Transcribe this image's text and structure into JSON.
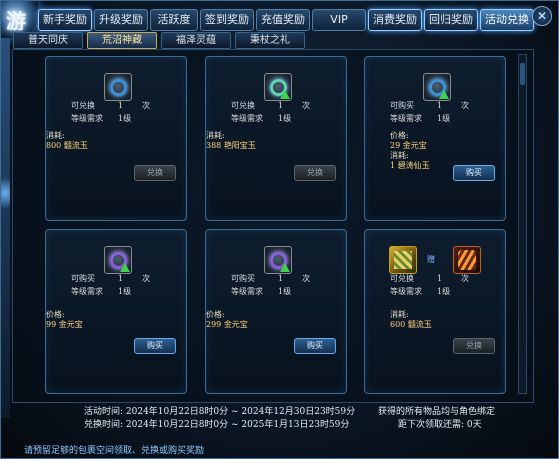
{
  "top_tabs": [
    "新手奖励",
    "升级奖励",
    "活跃度",
    "签到奖励",
    "充值奖励",
    "VIP",
    "消费奖励",
    "回归奖励",
    "活动兑换"
  ],
  "sub_tabs": [
    "普天同庆",
    "荒沼神藏",
    "福泽灵蕴",
    "秉杖之礼"
  ],
  "cards": [
    {
      "lines": [
        {
          "label": "可兑换",
          "value": "1",
          "unit": "次"
        },
        {
          "label": "等级需求",
          "value": "1级"
        }
      ],
      "cost_label": "消耗:",
      "cost": [
        "800 髓流玉"
      ],
      "button": "兑换",
      "icon": "blue-ring-icon"
    },
    {
      "lines": [
        {
          "label": "可兑换",
          "value": "1",
          "unit": "次"
        },
        {
          "label": "等级需求",
          "value": "1级"
        }
      ],
      "cost_label": "消耗:",
      "cost": [
        "388 艳阳宝玉"
      ],
      "button": "兑换",
      "icon": "teal-ring-icon"
    },
    {
      "lines": [
        {
          "label": "可购买",
          "value": "1",
          "unit": "次"
        },
        {
          "label": "等级需求",
          "value": "1级"
        }
      ],
      "cost_label": "价格:",
      "cost": [
        "29 金元宝"
      ],
      "extra_label": "消耗:",
      "extra": "1 碧涛仙玉",
      "button": "购买",
      "icon": "blue-ring-icon"
    },
    {
      "lines": [
        {
          "label": "可购买",
          "value": "1",
          "unit": "次"
        },
        {
          "label": "等级需求",
          "value": "1级"
        }
      ],
      "cost_label": "价格:",
      "cost": [
        "99 金元宝"
      ],
      "button": "购买",
      "icon": "purple-ring-icon"
    },
    {
      "lines": [
        {
          "label": "可购买",
          "value": "1",
          "unit": "次"
        },
        {
          "label": "等级需求",
          "value": "1级"
        }
      ],
      "cost_label": "价格:",
      "cost": [
        "299 金元宝"
      ],
      "button": "购买",
      "icon": "purple-ring-icon"
    },
    {
      "lines": [
        {
          "label": "可兑换",
          "value": "1",
          "unit": "次"
        },
        {
          "label": "等级需求",
          "value": "1级"
        }
      ],
      "cost_label": "消耗:",
      "cost": [
        "600 髓流玉"
      ],
      "button": "兑换",
      "gift_label": "赠",
      "icon": "gold-blade-icon"
    }
  ],
  "footer": {
    "activity_time": "活动时间: 2024年10月22日8时0分 ~ 2024年12月30日23时59分",
    "exchange_time": "兑换时间: 2024年10月22日8时0分 ~ 2025年1月13日23时59分",
    "bind_note": "获得的所有物品均与角色绑定",
    "countdown": "距下次领取还需: 0天"
  },
  "status": "请预留足够的包裹空间领取、兑换或购买奖励",
  "close_label": "✕",
  "logo": "游"
}
